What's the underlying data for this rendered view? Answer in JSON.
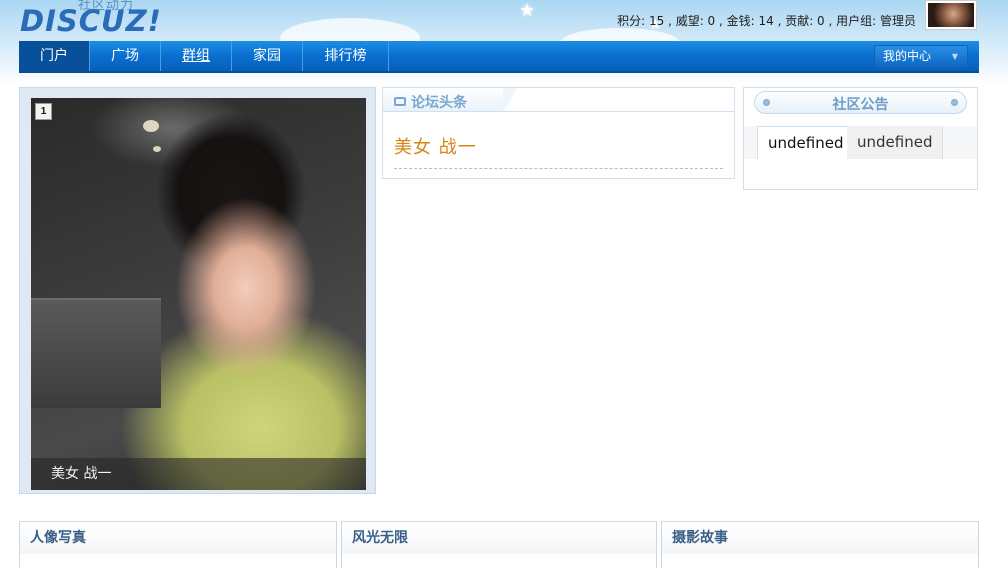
{
  "header": {
    "logo_text": "DISCUZ!",
    "logo_tagline": "社区动力",
    "user_stats": "积分: 15 , 威望: 0 , 金钱: 14 , 贡献: 0 , 用户组: 管理员"
  },
  "nav": {
    "items": [
      {
        "label": "门户",
        "active": true
      },
      {
        "label": "广场",
        "active": false
      },
      {
        "label": "群组",
        "active": false
      },
      {
        "label": "家园",
        "active": false
      },
      {
        "label": "排行榜",
        "active": false
      }
    ],
    "my_center_label": "我的中心"
  },
  "slideshow": {
    "current_index": "1",
    "caption": "美女 战一"
  },
  "headlines": {
    "title": "论坛头条",
    "items": [
      "美女 战一"
    ]
  },
  "announcement": {
    "title": "社区公告",
    "tabs": [
      "undefined",
      "undefined"
    ]
  },
  "categories": [
    {
      "label": "人像写真"
    },
    {
      "label": "风光无限"
    },
    {
      "label": "摄影故事"
    }
  ],
  "colors": {
    "nav_blue": "#0a6fcf",
    "headline_orange": "#d88518",
    "box_title_blue": "#7aa7cf"
  }
}
